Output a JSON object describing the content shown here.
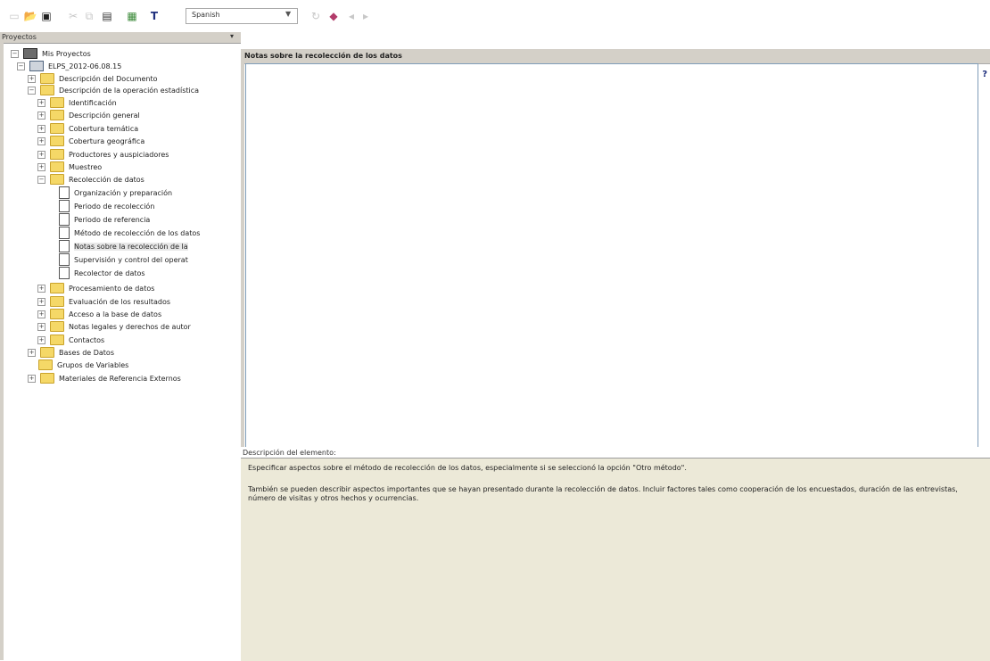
{
  "toolbar": {
    "language_value": "Spanish",
    "buttons": [
      "new",
      "open",
      "save",
      "cut",
      "copy",
      "paste",
      "template",
      "text",
      "language",
      "refresh",
      "bookmark",
      "back",
      "forward"
    ]
  },
  "left_panel": {
    "title": "Proyectos",
    "pin_symbol": "▾",
    "tree": {
      "root": "Mis Proyectos",
      "study": "ELPS_2012-06.08.15",
      "items": [
        "Descripción del Documento",
        "Descripción de la operación estadística",
        "Identificación",
        "Descripción general",
        "Cobertura temática",
        "Cobertura geográfica",
        "Productores y auspiciadores",
        "Muestreo",
        "Recolección de datos",
        "Organización y preparación",
        "Periodo de recolección",
        "Periodo de referencia",
        "Método de recolección de los datos",
        "Notas sobre la recolección de la",
        "Supervisión y control del operat",
        "Recolector de datos",
        "Procesamiento de datos",
        "Evaluación de los resultados",
        "Acceso a la base de datos",
        "Notas legales y derechos de autor",
        "Contactos",
        "Bases de Datos",
        "Grupos de Variables",
        "Materiales de Referencia Externos"
      ]
    }
  },
  "main": {
    "title": "Notas sobre la recolección de los datos",
    "description_title": "Descripción del elemento:",
    "description_lines": [
      "Especificar aspectos sobre el método de recolección de los datos, especialmente si se seleccionó la opción \"Otro método\".",
      "También se pueden describir aspectos importantes que se hayan presentado durante la recolección de datos. Incluir factores tales como cooperación de los encuestados, duración de las entrevistas,",
      "número de visitas y otros hechos y ocurrencias."
    ]
  }
}
